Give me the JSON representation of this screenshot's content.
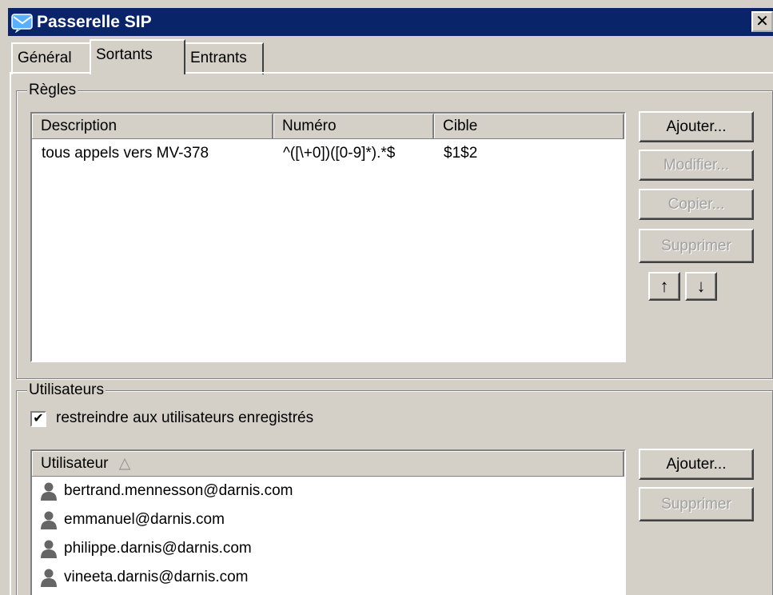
{
  "window": {
    "title": "Passerelle SIP",
    "close_glyph": "✕"
  },
  "tabs": [
    {
      "label": "Général"
    },
    {
      "label": "Sortants"
    },
    {
      "label": "Entrants"
    }
  ],
  "rules": {
    "legend": "Règles",
    "columns": [
      "Description",
      "Numéro",
      "Cible"
    ],
    "rows": [
      {
        "description": "tous appels vers MV-378",
        "numero": "^([\\+0])([0-9]*).*$",
        "cible": "$1$2"
      }
    ],
    "buttons": {
      "add": "Ajouter...",
      "modify": "Modifier...",
      "copy": "Copier...",
      "delete": "Supprimer",
      "up": "↑",
      "down": "↓"
    }
  },
  "users": {
    "legend": "Utilisateurs",
    "restrict_label": "restreindre aux utilisateurs enregistrés",
    "restrict_checked": true,
    "check_glyph": "✔",
    "column": "Utilisateur",
    "sort_glyph": "△",
    "list": [
      "bertrand.mennesson@darnis.com",
      "emmanuel@darnis.com",
      "philippe.darnis@darnis.com",
      "vineeta.darnis@darnis.com"
    ],
    "buttons": {
      "add": "Ajouter...",
      "delete": "Supprimer"
    }
  },
  "colors": {
    "titlebar": "#0a246a",
    "face": "#d4d0c8",
    "disabled_text": "#a0a0a0"
  }
}
